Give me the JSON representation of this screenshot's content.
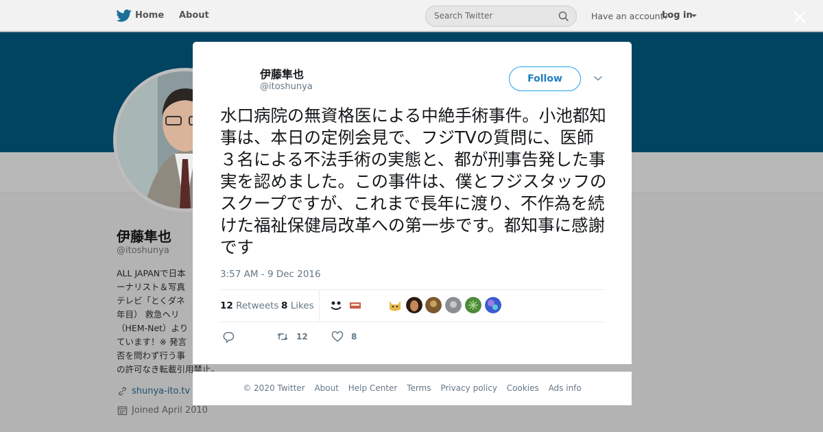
{
  "topnav": {
    "home_label": "Home",
    "about_label": "About",
    "search_placeholder": "Search Twitter",
    "have_account_label": "Have an account?",
    "login_label": "Log in"
  },
  "profile": {
    "name": "伊藤隼也",
    "handle": "@itoshunya",
    "bio_lines": [
      "ALL JAPANで日本",
      "ーナリスト＆写真",
      "テレビ「とくダネ",
      "年目） 救急ヘリ",
      "（HEM-Net）より",
      "ています！※ 発言",
      "否を問わず行う事",
      "の許可なき転載引用禁止。"
    ],
    "link": "shunya-ito.tv",
    "joined": "Joined April 2010"
  },
  "tweet": {
    "author_name": "伊藤隼也",
    "author_handle": "@itoshunya",
    "follow_label": "Follow",
    "text": "水口病院の無資格医による中絶手術事件。小池都知事は、本日の定例会見で、フジTVの質問に、医師３名による不法手術の実態と、都が刑事告発した事実を認めました。この事件は、僕とフジスタッフのスクープですが、これまで長年に渡り、不作為を続けた福祉保健局改革への第一歩です。都知事に感謝です",
    "timestamp": "3:57 AM - 9 Dec 2016",
    "retweets_count": "12",
    "retweets_label": "Retweets",
    "likes_count": "8",
    "likes_label": "Likes",
    "action_retweet_count": "12",
    "action_like_count": "8"
  },
  "footer": {
    "links": [
      "© 2020 Twitter",
      "About",
      "Help Center",
      "Terms",
      "Privacy policy",
      "Cookies",
      "Ads info"
    ]
  },
  "colors": {
    "banner": "#004461",
    "follow_border": "#1da1f2",
    "follow_text": "#1b7fc1",
    "secondary_text": "#657786"
  }
}
